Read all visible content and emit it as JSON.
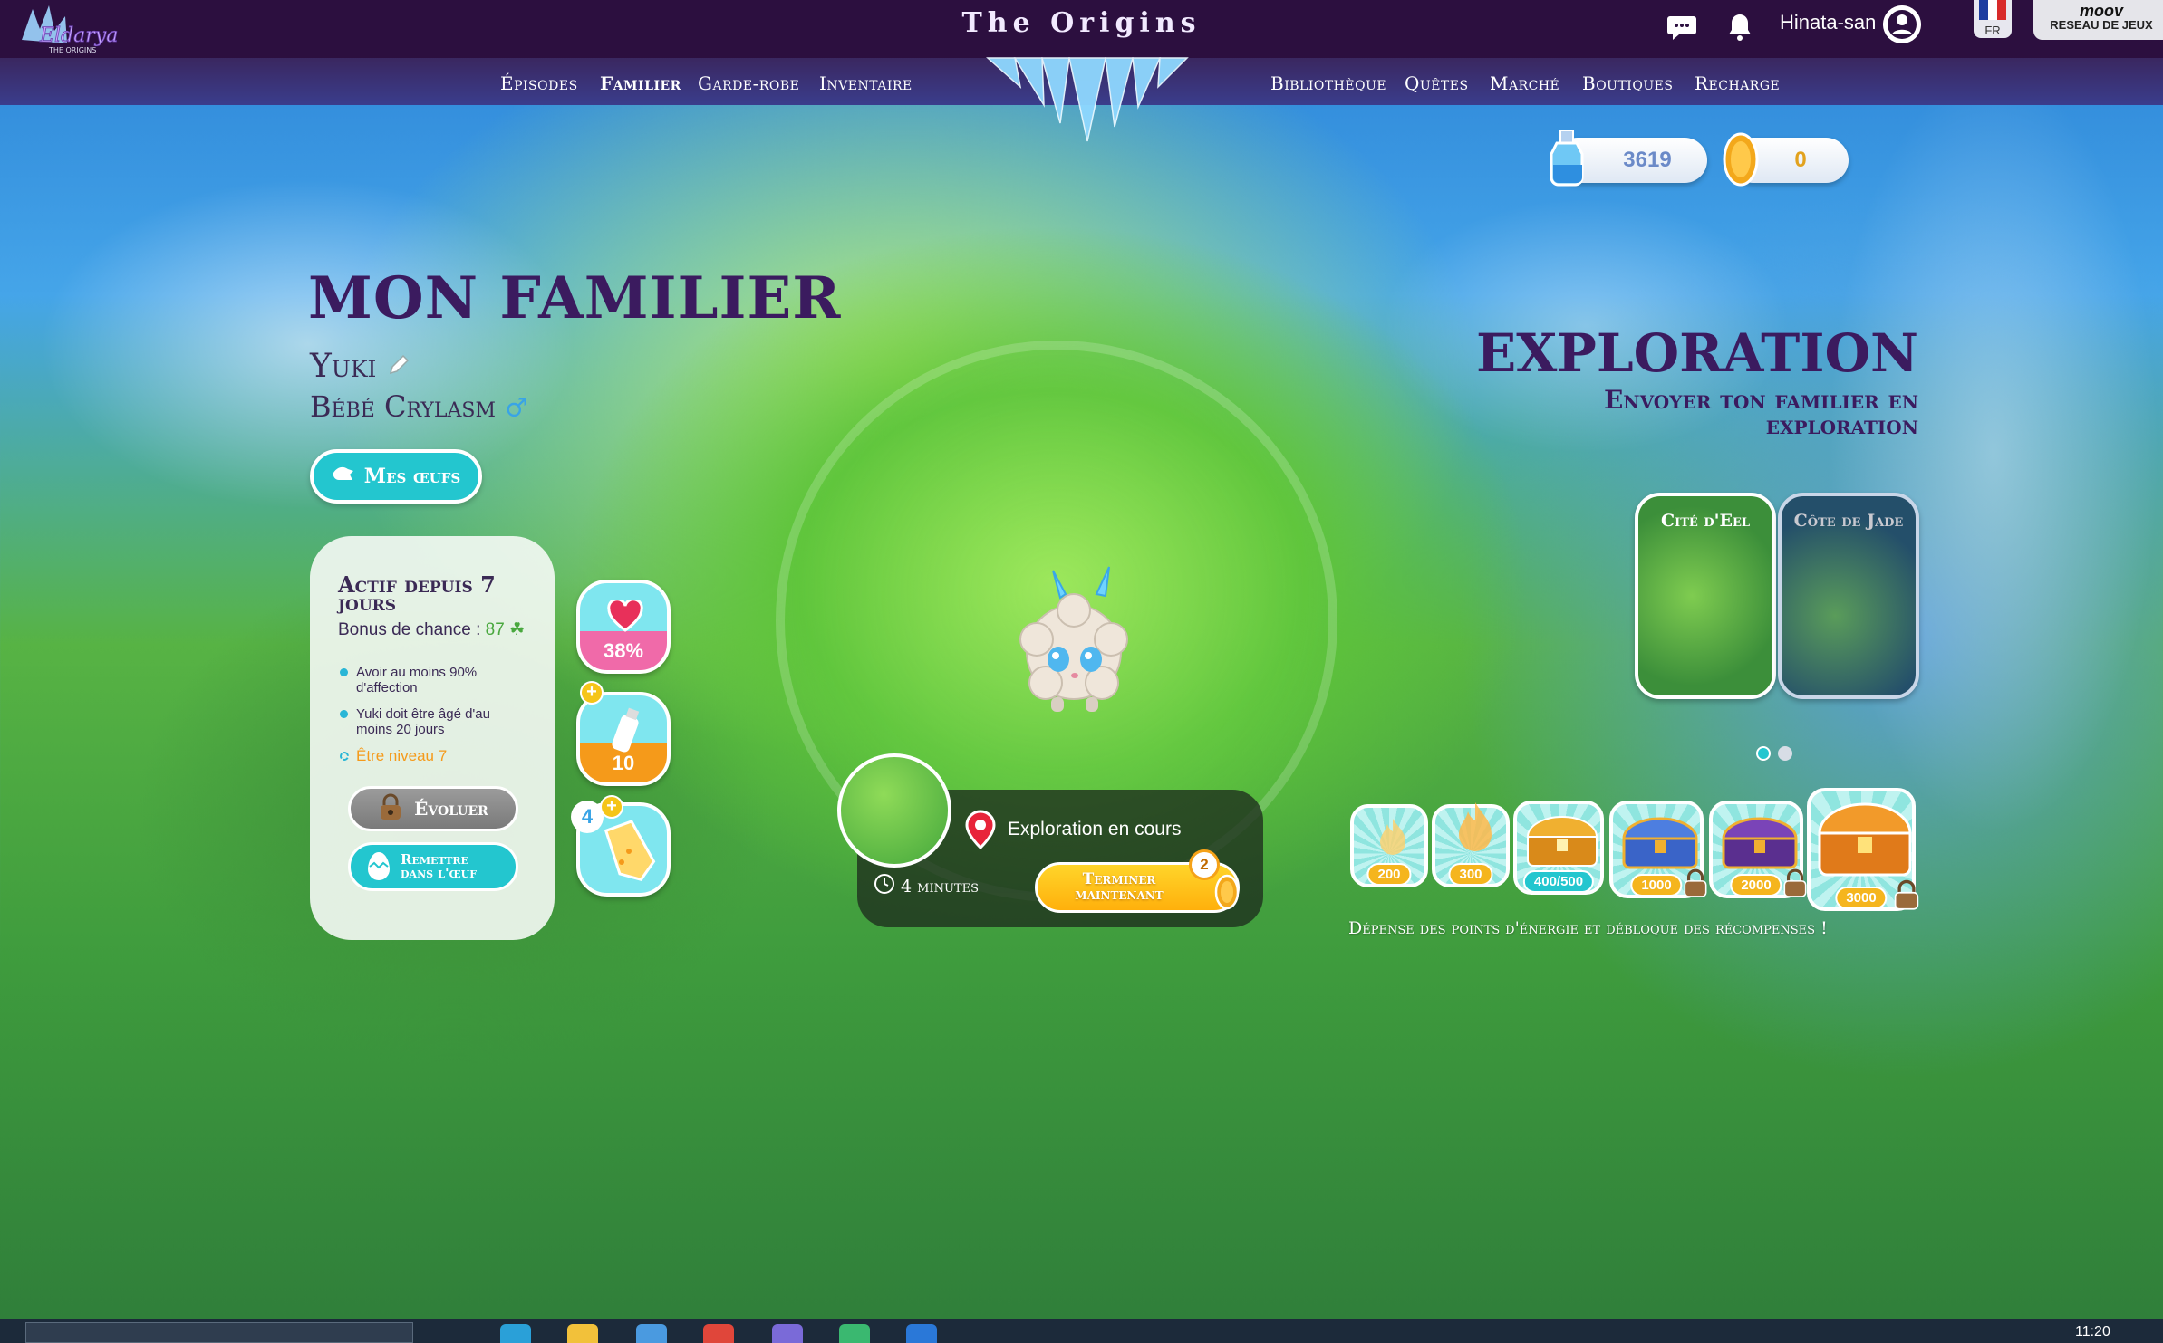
{
  "header": {
    "site_title": "The Origins",
    "username": "Hinata-san",
    "language": "FR",
    "partner": {
      "title": "moov",
      "subtitle": "RESEAU DE JEUX"
    }
  },
  "nav": {
    "left": [
      "Épisodes",
      "Familier",
      "Garde-robe",
      "Inventaire"
    ],
    "right": [
      "Bibliothèque",
      "Quêtes",
      "Marché",
      "Boutiques",
      "Recharge"
    ],
    "active": "Familier"
  },
  "currency": {
    "potions": "3619",
    "gold": "0"
  },
  "familier": {
    "title": "MON FAMILIER",
    "name": "Yuki",
    "species": "Bébé Crylasm",
    "eggs_button": "Mes œufs"
  },
  "status_card": {
    "title": "Actif depuis 7 jours",
    "bonus_label": "Bonus de chance : ",
    "bonus_value": "87",
    "requirements": [
      "Avoir au moins 90% d'affection",
      "Yuki doit être âgé d'au moins 20 jours",
      "Être niveau 7"
    ],
    "evolve_button": "Évoluer",
    "return_button": "Remettre dans l'œuf"
  },
  "stats": {
    "affection": "38%",
    "food": "10",
    "treat_count": "4"
  },
  "exploration": {
    "title": "EXPLORATION",
    "subtitle": "Envoyer ton familier en exploration",
    "status": "Exploration en cours",
    "timer": "4 minutes",
    "finish_button": "Terminer maintenant",
    "finish_cost": "2",
    "locations": [
      {
        "name": "Cité d'Eel",
        "active": true
      },
      {
        "name": "Côte de Jade",
        "active": false
      }
    ],
    "page_dots": [
      true,
      false
    ]
  },
  "rewards": {
    "tiers": [
      "200",
      "300",
      "400/500",
      "1000",
      "2000",
      "3000"
    ],
    "caption": "Dépense des points d'énergie et débloque des récompenses !"
  },
  "taskbar": {
    "time": "11:20"
  },
  "colors": {
    "header_bg": "#2c0f3f",
    "nav_bg": "#3a3d8c",
    "title_purple": "#3b1b5f",
    "teal": "#23c6cf",
    "gold": "#ffb00c"
  }
}
